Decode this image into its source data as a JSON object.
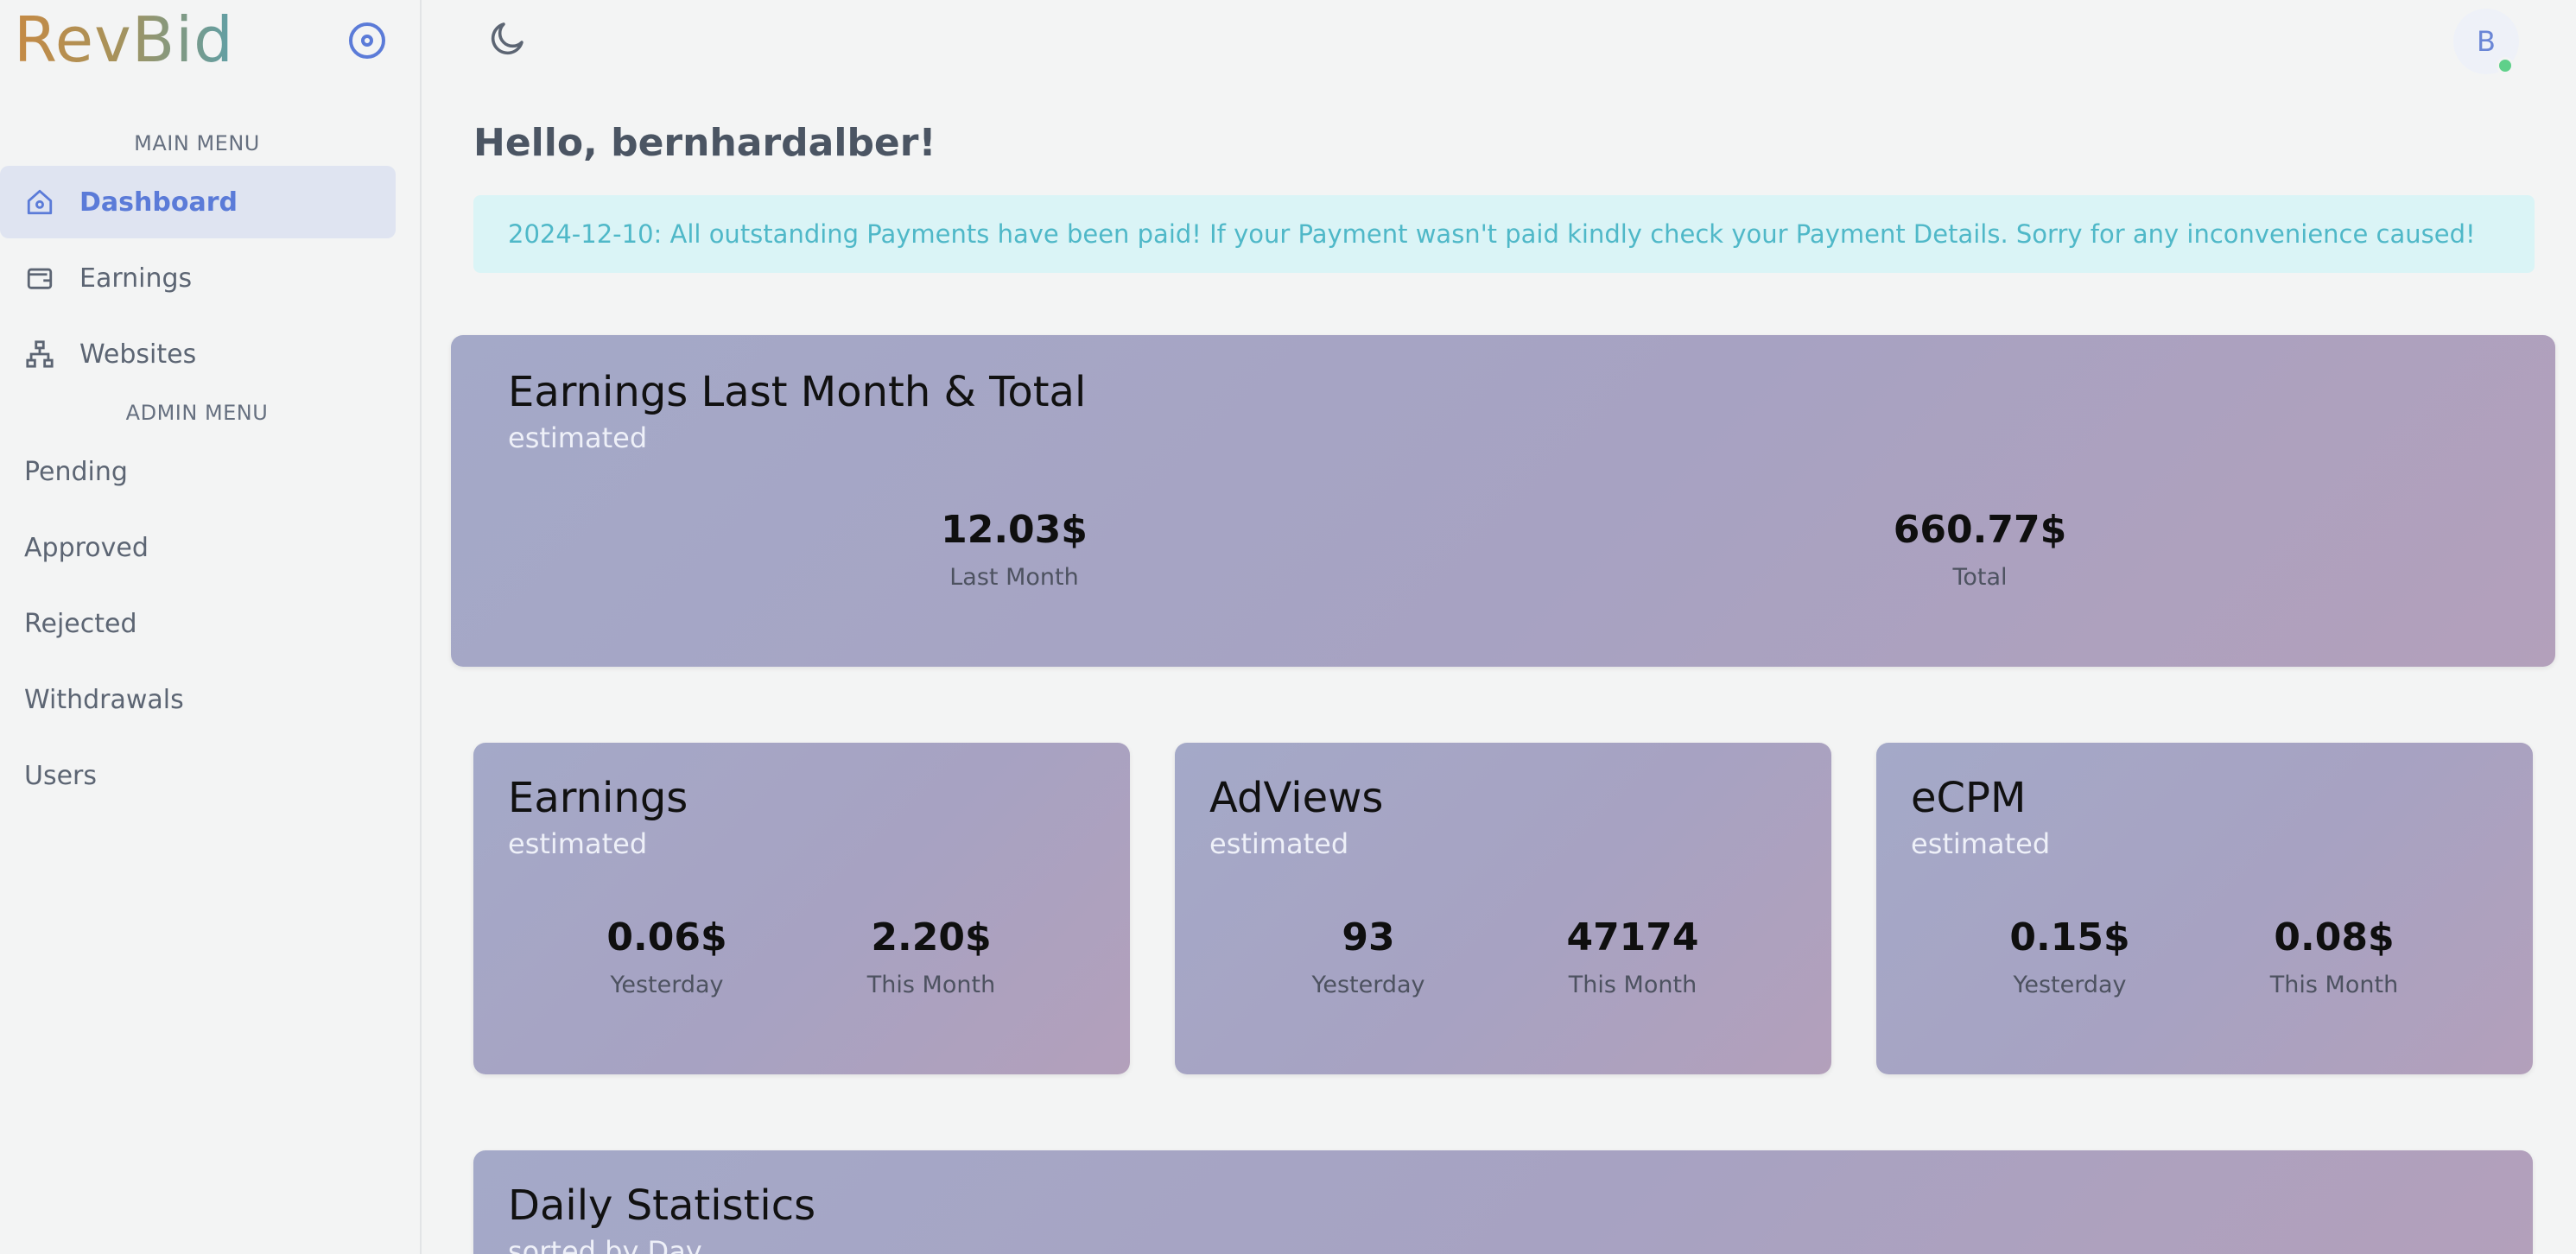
{
  "app": {
    "logo": "RevBid",
    "accent": "#5b7bd8"
  },
  "sidebar": {
    "main_heading": "MAIN MENU",
    "main_items": [
      {
        "label": "Dashboard",
        "icon": "home-icon"
      },
      {
        "label": "Earnings",
        "icon": "wallet-icon"
      },
      {
        "label": "Websites",
        "icon": "sitemap-icon"
      }
    ],
    "admin_heading": "ADMIN MENU",
    "admin_items": [
      {
        "label": "Pending"
      },
      {
        "label": "Approved"
      },
      {
        "label": "Rejected"
      },
      {
        "label": "Withdrawals"
      },
      {
        "label": "Users"
      }
    ]
  },
  "header": {
    "avatar_initial": "B"
  },
  "main": {
    "greeting": "Hello, bernhardalber!",
    "notice": "2024-12-10: All outstanding Payments have been paid! If your Payment wasn't paid kindly check your Payment Details. Sorry for any inconvenience caused!",
    "summary": {
      "title": "Earnings Last Month & Total",
      "subtitle": "estimated",
      "stats": [
        {
          "value": "12.03$",
          "label": "Last Month"
        },
        {
          "value": "660.77$",
          "label": "Total"
        }
      ]
    },
    "cards": [
      {
        "title": "Earnings",
        "subtitle": "estimated",
        "stats": [
          {
            "value": "0.06$",
            "label": "Yesterday"
          },
          {
            "value": "2.20$",
            "label": "This Month"
          }
        ]
      },
      {
        "title": "AdViews",
        "subtitle": "estimated",
        "stats": [
          {
            "value": "93",
            "label": "Yesterday"
          },
          {
            "value": "47174",
            "label": "This Month"
          }
        ]
      },
      {
        "title": "eCPM",
        "subtitle": "estimated",
        "stats": [
          {
            "value": "0.15$",
            "label": "Yesterday"
          },
          {
            "value": "0.08$",
            "label": "This Month"
          }
        ]
      }
    ],
    "daily": {
      "title": "Daily Statistics",
      "subtitle": "sorted by Day"
    }
  }
}
